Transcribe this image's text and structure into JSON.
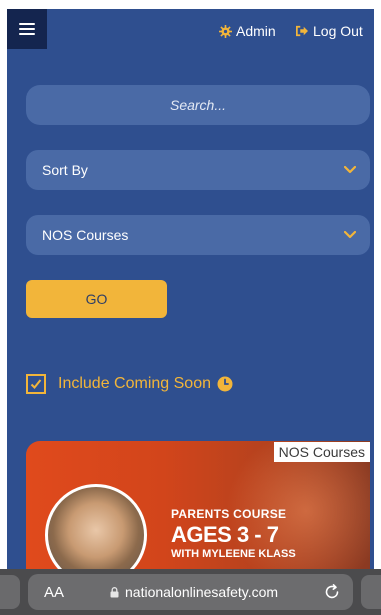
{
  "header": {
    "admin_label": "Admin",
    "logout_label": "Log Out"
  },
  "search": {
    "placeholder": "Search..."
  },
  "filters": {
    "sort_label": "Sort By",
    "category_label": "NOS Courses",
    "go_label": "GO"
  },
  "coming_soon": {
    "label": "Include Coming Soon",
    "checked": true
  },
  "card": {
    "tag": "NOS Courses",
    "line1": "PARENTS COURSE",
    "line2": "AGES 3 - 7",
    "line3": "WITH MYLEENE KLASS"
  },
  "browser": {
    "text_size_label": "AA",
    "url": "nationalonlinesafety.com"
  },
  "colors": {
    "background": "#2f4f8f",
    "field": "#4a6aa6",
    "accent": "#f2b53a",
    "menu": "#14254f"
  },
  "icons": [
    "menu-icon",
    "gear-icon",
    "logout-icon",
    "chevron-down-icon",
    "check-icon",
    "clock-icon",
    "lock-icon",
    "reload-icon"
  ]
}
